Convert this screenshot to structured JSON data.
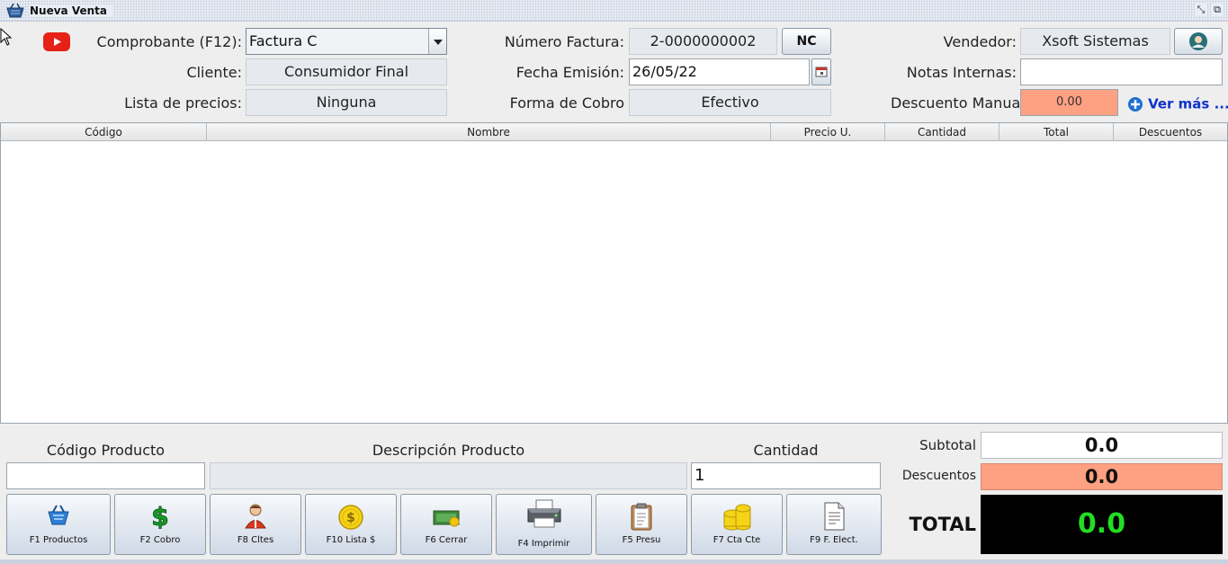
{
  "window": {
    "title": "Nueva Venta",
    "icon": "shopping-basket-icon"
  },
  "header": {
    "comprobante": {
      "label": "Comprobante (F12):",
      "value": "Factura C"
    },
    "cliente": {
      "label": "Cliente:",
      "value": "Consumidor Final"
    },
    "lista_precios": {
      "label": "Lista de precios:",
      "value": "Ninguna"
    },
    "numero_factura": {
      "label": "Número Factura:",
      "value": "2-0000000002",
      "button": "NC"
    },
    "fecha_emision": {
      "label": "Fecha Emisión:",
      "value": "26/05/22"
    },
    "forma_cobro": {
      "label": "Forma de Cobro",
      "value": "Efectivo"
    },
    "vendedor": {
      "label": "Vendedor:",
      "value": "Xsoft Sistemas"
    },
    "notas_internas": {
      "label": "Notas Internas:",
      "value": ""
    },
    "descuento_manual": {
      "label": "Descuento Manual",
      "value": "0.00"
    },
    "ver_mas": "Ver más ..."
  },
  "table": {
    "columns": [
      "Código",
      "Nombre",
      "Precio U.",
      "Cantidad",
      "Total",
      "Descuentos"
    ],
    "rows": []
  },
  "entry": {
    "codigo_label": "Código Producto",
    "codigo_value": "",
    "descripcion_label": "Descripción Producto",
    "descripcion_value": "",
    "cantidad_label": "Cantidad",
    "cantidad_value": "1"
  },
  "buttons": [
    {
      "label": "F1 Productos",
      "icon": "basket-icon"
    },
    {
      "label": "F2 Cobro",
      "icon": "dollar-icon"
    },
    {
      "label": "F8 Cltes",
      "icon": "person-icon"
    },
    {
      "label": "F10 Lista $",
      "icon": "coin-icon"
    },
    {
      "label": "F6 Cerrar",
      "icon": "cash-icon"
    },
    {
      "label": "F4 Imprimir",
      "icon": "printer-icon"
    },
    {
      "label": "F5 Presu",
      "icon": "clipboard-icon"
    },
    {
      "label": "F7 Cta Cte",
      "icon": "coins-stack-icon"
    },
    {
      "label": "F9 F. Elect.",
      "icon": "document-icon"
    }
  ],
  "totals": {
    "subtotal_label": "Subtotal",
    "subtotal_value": "0.0",
    "descuentos_label": "Descuentos",
    "descuentos_value": "0.0",
    "total_label": "TOTAL",
    "total_value": "0.0"
  },
  "colors": {
    "discount_bg": "#fea082",
    "total_bg": "#000000",
    "total_fg": "#22dd22",
    "link": "#1133cc"
  }
}
